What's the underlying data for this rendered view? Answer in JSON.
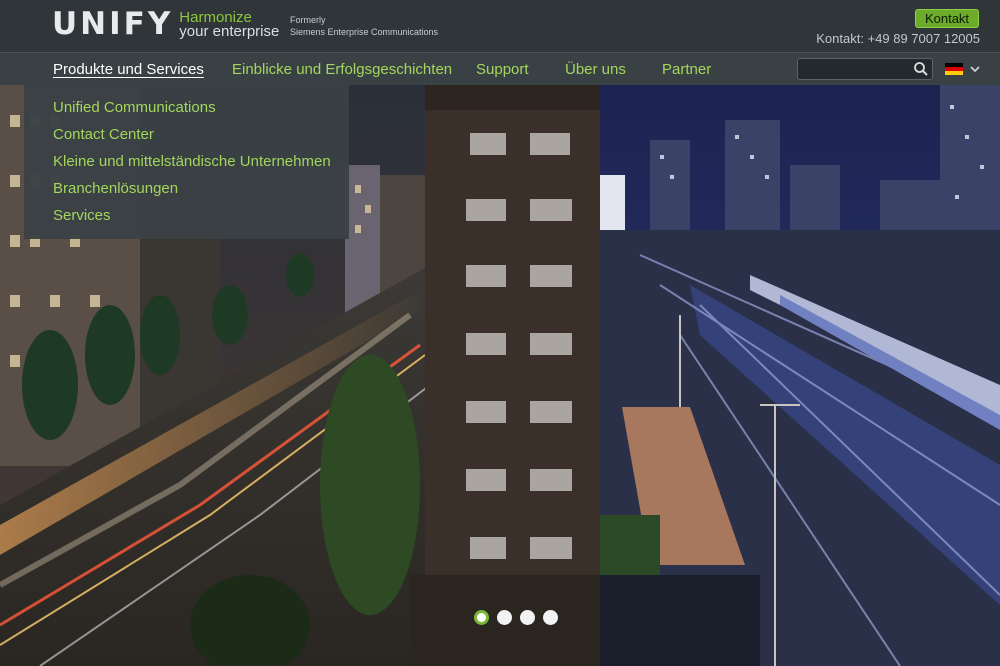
{
  "header": {
    "logo_word": "UNIFY",
    "logo_tagline_1": "Harmonize",
    "logo_tagline_2": "your enterprise",
    "formerly_1": "Formerly",
    "formerly_2": "Siemens Enterprise Communications",
    "contact_button": "Kontakt",
    "phone": "Kontakt: +49 89 7007 12005"
  },
  "nav": {
    "items": [
      {
        "label": "Produkte und Services",
        "active": true
      },
      {
        "label": "Einblicke und Erfolgsgeschichten"
      },
      {
        "label": "Support"
      },
      {
        "label": "Über uns"
      },
      {
        "label": "Partner"
      }
    ],
    "search_placeholder": "",
    "search_icon": "search-icon",
    "language_flag": "de-flag"
  },
  "dropdown": {
    "items": [
      "Unified Communications",
      "Contact Center",
      "Kleine und mittelständische Unternehmen",
      "Branchenlösungen",
      "Services"
    ]
  },
  "slider": {
    "dots": 4,
    "active_index": 0
  },
  "colors": {
    "accent_green": "#8cc63f",
    "nav_green": "#a3d65c",
    "header_bg": "#2f3539",
    "nav_bg": "#3a4145"
  }
}
